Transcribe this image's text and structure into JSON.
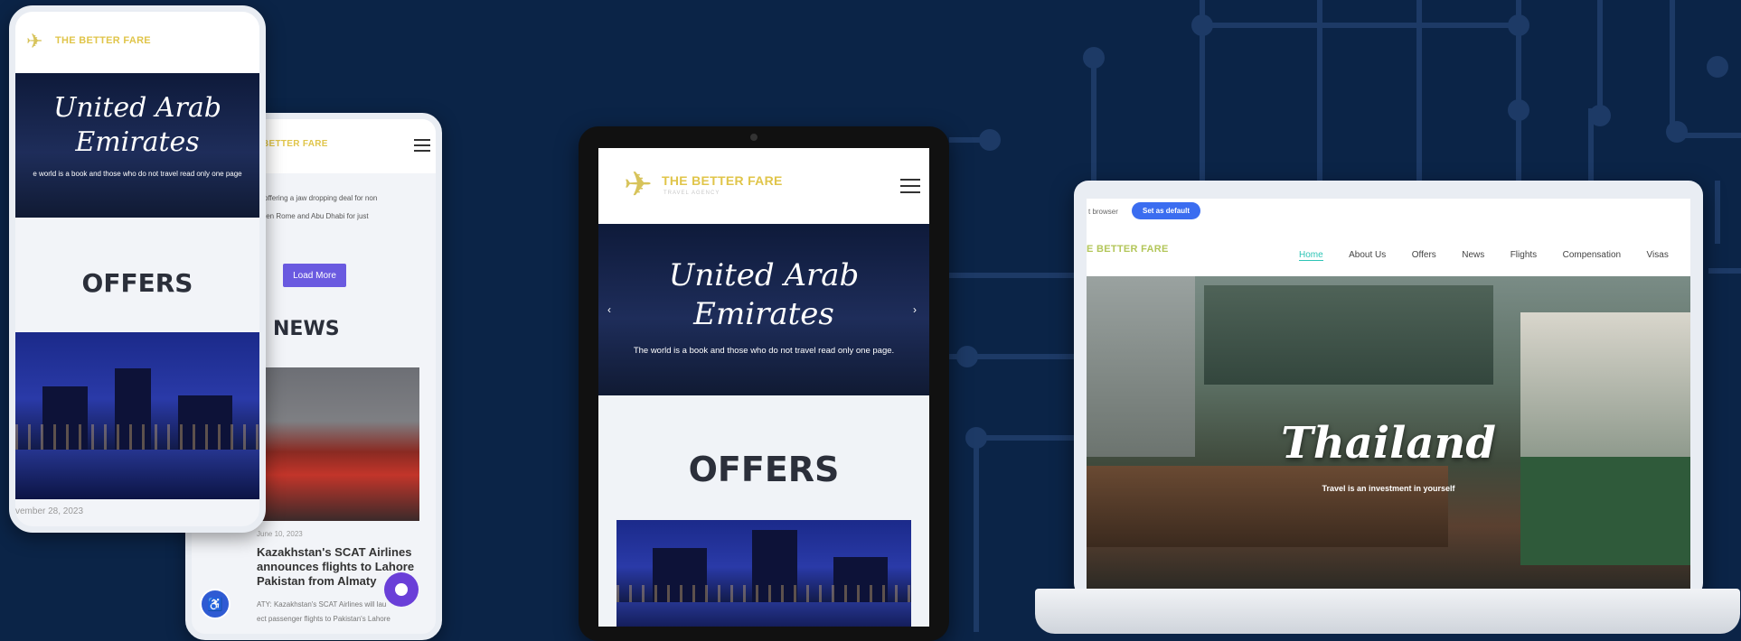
{
  "brand": {
    "name": "THE BETTER FARE",
    "name_partial": "E BETTER FARE",
    "name_partial_small": "BETTER FARE",
    "subtitle": "TRAVEL AGENCY"
  },
  "phone1": {
    "hero_title_line1": "United Arab",
    "hero_title_line2": "Emirates",
    "hero_tagline": "e world is a book and those who do not travel read only one page",
    "section_title": "OFFERS",
    "date": "vember 28, 2023",
    "menu_icon": "kebab-icon"
  },
  "phone2": {
    "offer_text_line1": "is offering a jaw dropping deal for non",
    "offer_text_line2": "ween Rome and Abu Dhabi for just",
    "load_more": "Load More",
    "section_title": "NEWS",
    "article_date": "June 10, 2023",
    "article_title": "Kazakhstan's SCAT Airlines announces flights to Lahore Pakistan from Almaty",
    "article_excerpt_line1": "ATY: Kazakhstan's SCAT Airlines will lau",
    "article_excerpt_line2": "ect passenger flights to Pakistan's Lahore",
    "menu_icon": "hamburger-icon",
    "chat_icon": "chat-bubble-icon",
    "accessibility_icon": "accessibility-icon"
  },
  "tablet": {
    "hero_title_line1": "United Arab",
    "hero_title_line2": "Emirates",
    "hero_tagline": "The world is a book and those who do not travel read only one page.",
    "section_title": "OFFERS",
    "prev_icon": "chevron-left-icon",
    "next_icon": "chevron-right-icon"
  },
  "laptop": {
    "browser_text": "t browser",
    "set_default": "Set as default",
    "nav": [
      "Home",
      "About Us",
      "Offers",
      "News",
      "Flights",
      "Compensation",
      "Visas"
    ],
    "hero_title": "Thailand",
    "hero_tagline": "Travel is an investment in yourself"
  },
  "colors": {
    "background": "#0b2447",
    "accent": "#6a5ae0",
    "nav_active": "#2ec4b6",
    "logo": "#e0c54a"
  }
}
